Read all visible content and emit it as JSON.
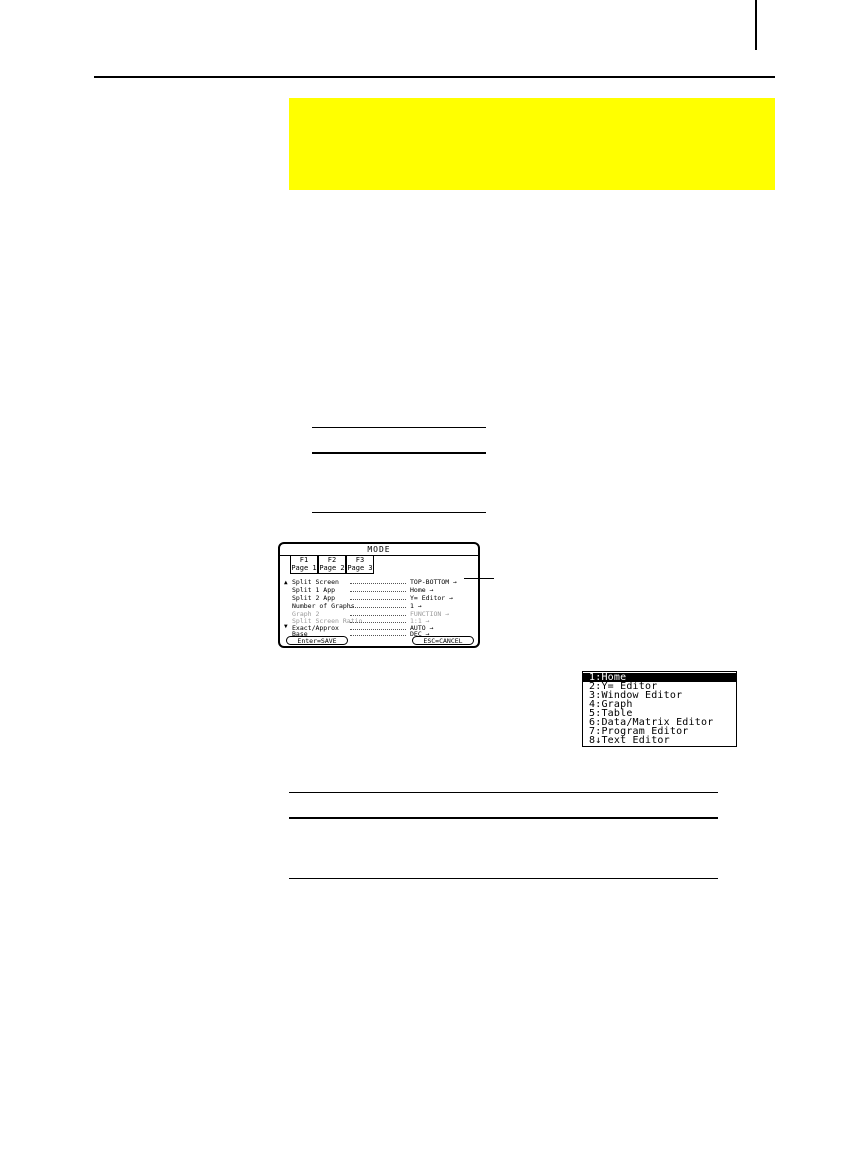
{
  "mode_dialog": {
    "title": "MODE",
    "tabs": [
      {
        "key": "F1",
        "label": "Page 1"
      },
      {
        "key": "F2",
        "label": "Page 2"
      },
      {
        "key": "F3",
        "label": "Page 3"
      }
    ],
    "settings": [
      {
        "label": "Split Screen",
        "value": "TOP-BOTTOM →"
      },
      {
        "label": "Split 1 App",
        "value": "Home →"
      },
      {
        "label": "Split 2 App",
        "value": "Y= Editor →"
      },
      {
        "label": "Number of Graphs",
        "value": "1 →"
      },
      {
        "label": "Graph 2",
        "value": "FUNCTION →"
      },
      {
        "label": "Split Screen Ratio",
        "value": "1:1 →"
      },
      {
        "label": "Exact/Approx",
        "value": "AUTO →"
      },
      {
        "label": "Base",
        "value": "DEC →"
      }
    ],
    "save_label": "Enter=SAVE",
    "cancel_label": "ESC=CANCEL"
  },
  "app_menu": {
    "items": [
      "1:Home",
      "2:Y= Editor",
      "3:Window Editor",
      "4:Graph",
      "5:Table",
      "6:Data/Matrix Editor",
      "7:Program Editor",
      "8↓Text Editor"
    ]
  },
  "colors": {
    "highlight": "#ffff00",
    "ink": "#000000"
  }
}
